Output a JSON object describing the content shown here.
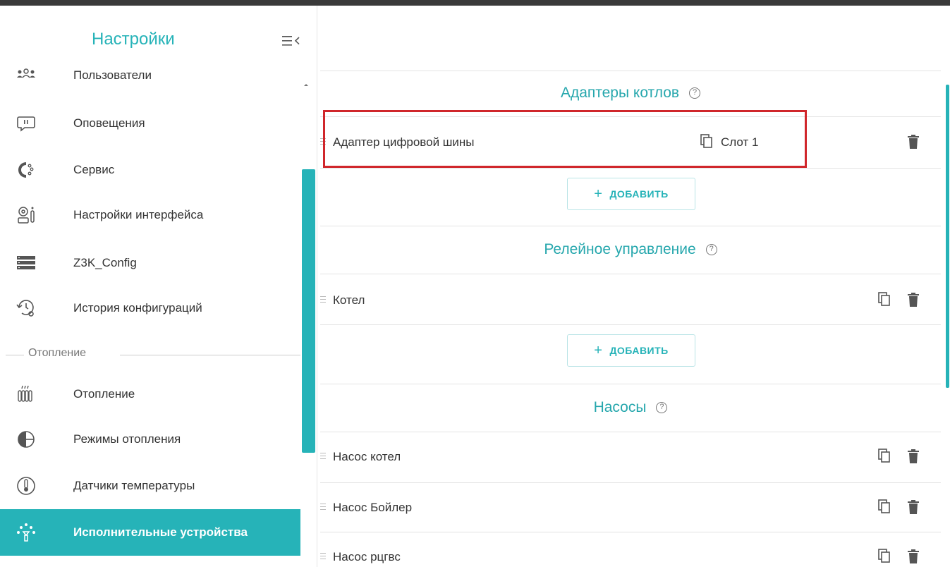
{
  "sidebar": {
    "title": "Настройки",
    "items": [
      {
        "label": "Пользователи",
        "icon": "users-icon"
      },
      {
        "label": "Оповещения",
        "icon": "alert-message-icon"
      },
      {
        "label": "Сервис",
        "icon": "service-gear-icon"
      },
      {
        "label": "Настройки интерфейса",
        "icon": "interface-settings-icon"
      },
      {
        "label": "Z3K_Config",
        "icon": "server-list-icon"
      },
      {
        "label": "История конфигураций",
        "icon": "config-history-icon"
      }
    ],
    "section_label": "Отопление",
    "heating_items": [
      {
        "label": "Отопление",
        "icon": "radiator-icon"
      },
      {
        "label": "Режимы отопления",
        "icon": "heating-modes-icon"
      },
      {
        "label": "Датчики температуры",
        "icon": "thermometer-icon"
      },
      {
        "label": "Исполнительные устройства",
        "icon": "actuators-icon",
        "active": true
      }
    ]
  },
  "main": {
    "sections": [
      {
        "title": "Адаптеры котлов",
        "rows": [
          {
            "label": "Адаптер цифровой шины",
            "slot": "Слот 1"
          }
        ],
        "add_label": "ДОБАВИТЬ"
      },
      {
        "title": "Релейное управление",
        "rows": [
          {
            "label": "Котел"
          }
        ],
        "add_label": "ДОБАВИТЬ"
      },
      {
        "title": "Насосы",
        "rows": [
          {
            "label": "Насос котел"
          },
          {
            "label": "Насос Бойлер"
          },
          {
            "label": "Насос рцгвс"
          }
        ]
      }
    ]
  },
  "colors": {
    "accent": "#26b3b8",
    "highlight": "#d0262b"
  }
}
